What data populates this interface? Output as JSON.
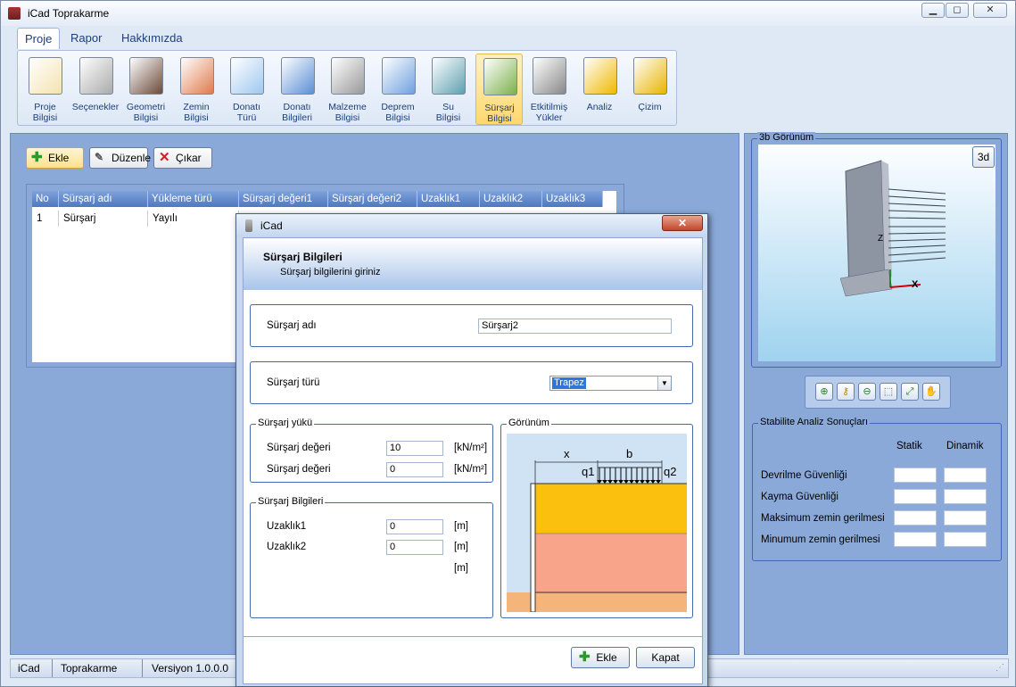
{
  "window": {
    "title": "iCad Toprakarme",
    "min": "▭",
    "max": "◻",
    "close": "✕"
  },
  "menu": [
    "Proje",
    "Rapor",
    "Hakkımızda"
  ],
  "ribbon": [
    {
      "l1": "Proje",
      "l2": "Bilgisi",
      "icon": "clipboard-icon"
    },
    {
      "l1": "Seçenekler",
      "l2": "",
      "icon": "gears-icon"
    },
    {
      "l1": "Geometri",
      "l2": "Bilgisi",
      "icon": "box-icon"
    },
    {
      "l1": "Zemin",
      "l2": "Bilgisi",
      "icon": "soil-layers-icon"
    },
    {
      "l1": "Donatı",
      "l2": "Türü",
      "icon": "mesh-icon"
    },
    {
      "l1": "Donatı",
      "l2": "Bilgileri",
      "icon": "bars-icon"
    },
    {
      "l1": "Malzeme",
      "l2": "Bilgisi",
      "icon": "silo-icon"
    },
    {
      "l1": "Deprem",
      "l2": "Bilgisi",
      "icon": "wave-chart-icon"
    },
    {
      "l1": "Su",
      "l2": "Bilgisi",
      "icon": "water-box-icon"
    },
    {
      "l1": "Sürşarj",
      "l2": "Bilgisi",
      "icon": "surcharge-icon"
    },
    {
      "l1": "Etkitilmiş",
      "l2": "Yükler",
      "icon": "hook-icon"
    },
    {
      "l1": "Analiz",
      "l2": "",
      "icon": "lightning-icon"
    },
    {
      "l1": "Çizim",
      "l2": "",
      "icon": "triangle-ruler-icon"
    }
  ],
  "toolbar": {
    "add": "Ekle",
    "edit": "Düzenle",
    "remove": "Çıkar"
  },
  "grid": {
    "headers": [
      "No",
      "Sürşarj adı",
      "Yükleme türü",
      "Sürşarj değeri1",
      "Sürşarj değeri2",
      "Uzaklık1",
      "Uzaklık2",
      "Uzaklık3"
    ],
    "rows": [
      [
        "1",
        "Sürşarj",
        "Yayılı"
      ]
    ]
  },
  "view3d": {
    "title": "3b Görünüm",
    "button": "3d",
    "axis_x": "X",
    "axis_z": "Z"
  },
  "results": {
    "title": "Stabilite Analiz Sonuçları",
    "col_static": "Statik",
    "col_dynamic": "Dinamik",
    "rows": [
      "Devrilme Güvenliği",
      "Kayma Güvenliği",
      "Maksimum zemin gerilmesi",
      "Minumum zemin gerilmesi"
    ]
  },
  "status": {
    "app": "iCad",
    "module": "Toprakarme",
    "version": "Versiyon 1.0.0.0"
  },
  "dialog": {
    "title": "iCad",
    "close": "✕",
    "header": "Sürşarj Bilgileri",
    "subheader": "Sürşarj bilgilerini giriniz",
    "name_label": "Sürşarj adı",
    "name_value": "Sürşarj2",
    "type_label": "Sürşarj türü",
    "type_value": "Trapez",
    "load_group": "Sürşarj yükü",
    "load1_label": "Sürşarj değeri",
    "load1_value": "10",
    "load2_label": "Sürşarj değeri",
    "load2_value": "0",
    "load_unit": "[kN/m²]",
    "info_group": "Sürşarj Bilgileri",
    "dist1_label": "Uzaklık1",
    "dist1_value": "0",
    "dist2_label": "Uzaklık2",
    "dist2_value": "0",
    "dist_unit": "[m]",
    "preview_group": "Görünüm",
    "preview": {
      "x": "x",
      "b": "b",
      "q1": "q1",
      "q2": "q2"
    },
    "add_button": "Ekle",
    "close_button": "Kapat"
  }
}
